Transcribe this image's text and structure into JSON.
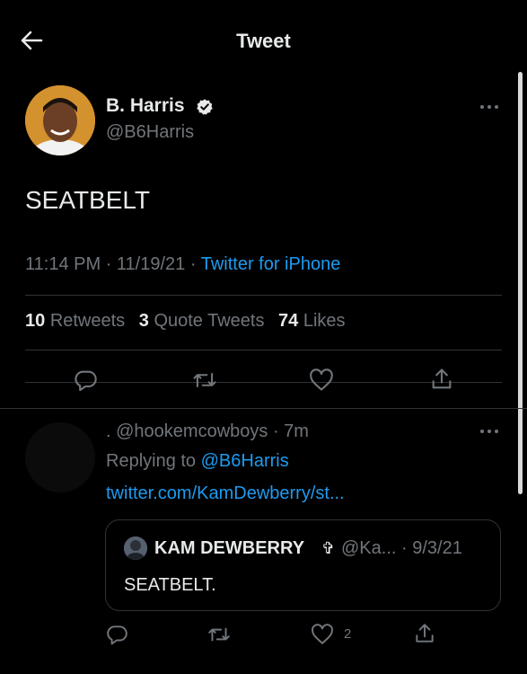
{
  "header": {
    "title": "Tweet",
    "back_icon": "arrow-left-icon"
  },
  "tweet": {
    "author_name": "B. Harris",
    "author_handle": "@B6Harris",
    "text": "SEATBELT",
    "time": "11:14 PM",
    "date": "11/19/21",
    "source": "Twitter for iPhone",
    "stats": {
      "retweets_count": "10",
      "retweets_label": "Retweets",
      "quotes_count": "3",
      "quotes_label": "Quote Tweets",
      "likes_count": "74",
      "likes_label": "Likes"
    },
    "actions": [
      "reply-icon",
      "retweet-icon",
      "like-icon",
      "share-icon"
    ]
  },
  "reply": {
    "handle_line": ". @hookemcowboys · 7m",
    "replying_prefix": "Replying to",
    "replying_to": "@B6Harris",
    "link": "twitter.com/KamDewberry/st...",
    "quote": {
      "name": "KAM DEWBERRY",
      "name_emoji": "✞",
      "handle_date": "@Ka... · 9/3/21",
      "text": "SEATBELT."
    },
    "like_count": "2"
  },
  "colors": {
    "background": "#000000",
    "text": "#e7e9ea",
    "muted": "#71767b",
    "accent": "#1d9bf0",
    "border": "#2f3336"
  }
}
